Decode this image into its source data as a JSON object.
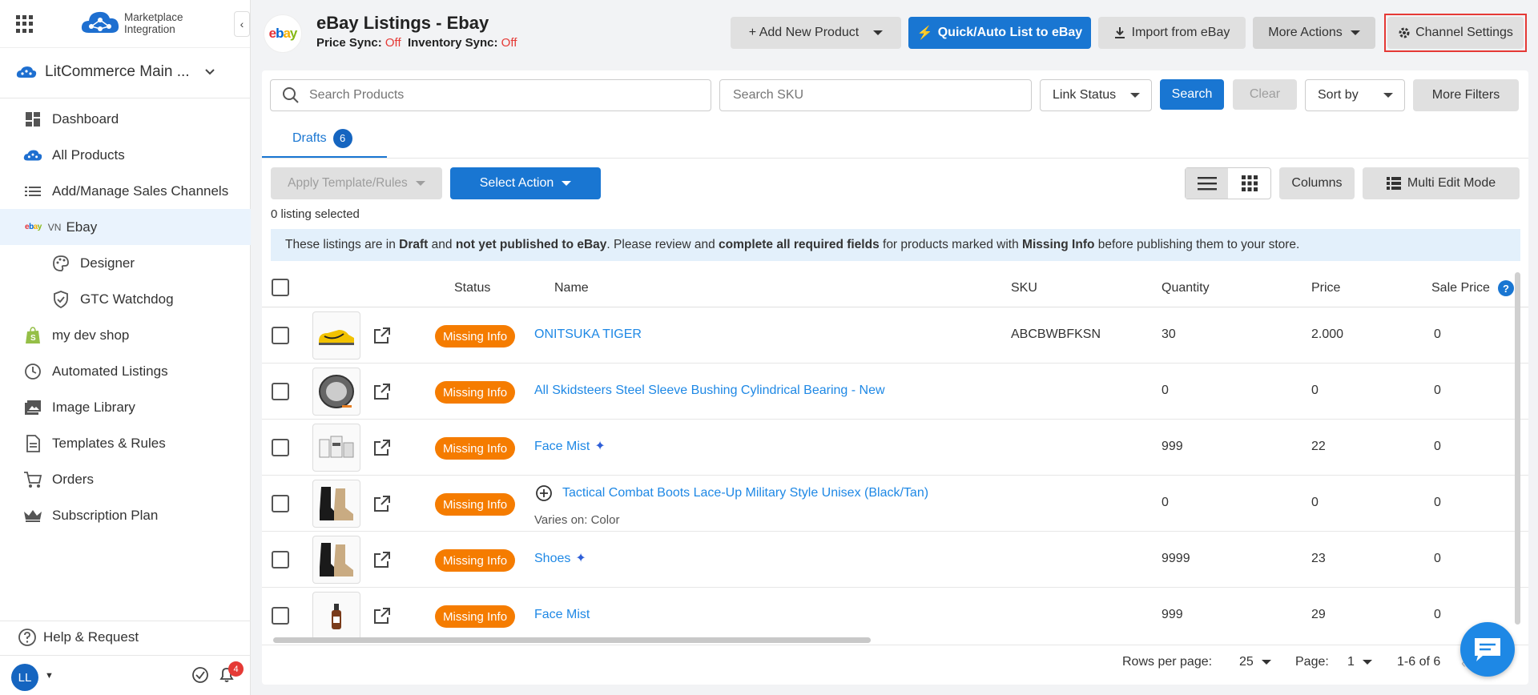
{
  "sidebar": {
    "logo_text_line1": "Marketplace",
    "logo_text_line2": "Integration",
    "collapse_glyph": "‹",
    "store_name": "LitCommerce Main ...",
    "nav": [
      {
        "label": "Dashboard",
        "icon": "dashboard-icon"
      },
      {
        "label": "All Products",
        "icon": "cloud-products-icon"
      },
      {
        "label": "Add/Manage Sales Channels",
        "icon": "list-icon"
      },
      {
        "label": "Ebay",
        "icon": "ebay-icon",
        "prefix": "VN",
        "active": true
      },
      {
        "label": "Designer",
        "icon": "palette-icon",
        "sub": true
      },
      {
        "label": "GTC Watchdog",
        "icon": "shield-check-icon",
        "sub": true
      },
      {
        "label": "my dev shop",
        "icon": "shopify-icon"
      },
      {
        "label": "Automated Listings",
        "icon": "clock-icon"
      },
      {
        "label": "Image Library",
        "icon": "image-icon"
      },
      {
        "label": "Templates & Rules",
        "icon": "document-icon"
      },
      {
        "label": "Orders",
        "icon": "cart-icon"
      },
      {
        "label": "Subscription Plan",
        "icon": "crown-icon"
      }
    ],
    "help_label": "Help & Request",
    "avatar_initials": "LL",
    "notification_count": "4"
  },
  "header": {
    "title": "eBay Listings - Ebay",
    "price_sync_label": "Price Sync:",
    "price_sync_value": "Off",
    "inventory_sync_label": "Inventory Sync:",
    "inventory_sync_value": "Off",
    "add_product_label": "+ Add New Product",
    "quick_list_label": "Quick/Auto List to eBay",
    "import_label": "Import from eBay",
    "more_actions_label": "More Actions",
    "channel_settings_label": "Channel Settings"
  },
  "filters": {
    "search_placeholder": "Search Products",
    "sku_placeholder": "Search SKU",
    "link_status_label": "Link Status",
    "search_button": "Search",
    "clear_button": "Clear",
    "sort_by_label": "Sort by",
    "more_filters_button": "More Filters"
  },
  "tabs": [
    {
      "label": "Drafts",
      "count": "6"
    }
  ],
  "toolbar": {
    "apply_template_label": "Apply Template/Rules",
    "select_action_label": "Select Action",
    "columns_label": "Columns",
    "multi_edit_label": "Multi Edit Mode",
    "selected_text": "0 listing selected"
  },
  "info_bar": {
    "t1": "These listings are in ",
    "b1": "Draft",
    "t2": " and ",
    "b2": "not yet published to eBay",
    "t3": ". Please review and ",
    "b3": "complete all required fields",
    "t4": " for products marked with ",
    "b4": "Missing Info",
    "t5": " before publishing them to your store."
  },
  "table": {
    "headers": {
      "status": "Status",
      "name": "Name",
      "sku": "SKU",
      "quantity": "Quantity",
      "price": "Price",
      "sale_price": "Sale Price"
    },
    "rows": [
      {
        "status": "Missing Info",
        "name": "ONITSUKA TIGER",
        "sku": "ABCBWBFKSN",
        "quantity": "30",
        "price": "2.000",
        "sale_price": "0"
      },
      {
        "status": "Missing Info",
        "name": "All Skidsteers Steel Sleeve Bushing Cylindrical Bearing - New",
        "sku": "",
        "quantity": "0",
        "price": "0",
        "sale_price": "0"
      },
      {
        "status": "Missing Info",
        "name": "Face Mist",
        "sparkle": "✦",
        "sku": "",
        "quantity": "999",
        "price": "22",
        "sale_price": "0"
      },
      {
        "status": "Missing Info",
        "name": "Tactical Combat Boots Lace-Up Military Style Unisex (Black/Tan)",
        "varies": "Varies on: Color",
        "sku": "",
        "quantity": "0",
        "price": "0",
        "sale_price": "0"
      },
      {
        "status": "Missing Info",
        "name": "Shoes",
        "sparkle": "✦",
        "sku": "",
        "quantity": "9999",
        "price": "23",
        "sale_price": "0"
      },
      {
        "status": "Missing Info",
        "name": "Face Mist",
        "sku": "",
        "quantity": "999",
        "price": "29",
        "sale_price": "0"
      }
    ]
  },
  "pagination": {
    "rows_per_page_label": "Rows per page:",
    "rows_per_page_value": "25",
    "page_label": "Page:",
    "page_value": "1",
    "range_text": "1-6 of 6"
  },
  "colors": {
    "primary": "#1976d2",
    "status_missing": "#f57c00",
    "off": "#e53935",
    "highlight_outline": "#e53935"
  }
}
